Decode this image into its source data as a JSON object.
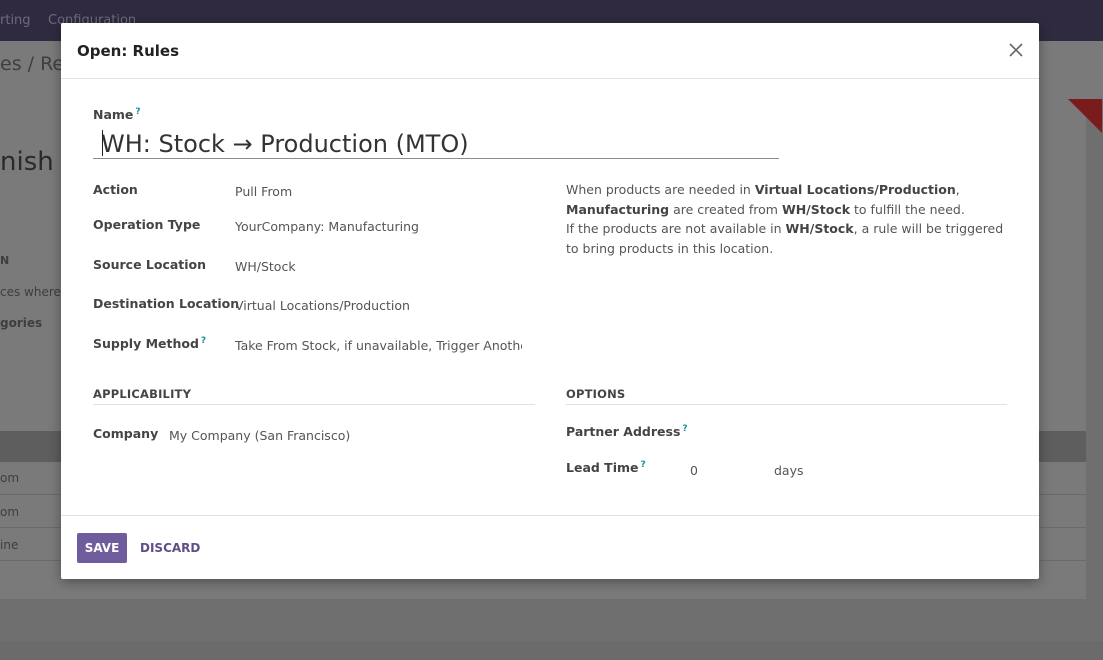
{
  "background": {
    "menu_items": [
      "rting",
      "Configuration"
    ],
    "breadcrumb": "es / Rep",
    "record_title": "nish o",
    "section_label": "N",
    "helper_text": "ces where",
    "categories_label": "gories",
    "rows": [
      "om",
      "om",
      "ine"
    ]
  },
  "modal": {
    "title": "Open: Rules",
    "close_icon": "close-icon"
  },
  "form": {
    "name_label": "Name",
    "name_value": "WH: Stock → Production (MTO)",
    "help_marker": "?",
    "fields": {
      "action_label": "Action",
      "action_value": "Pull From",
      "operation_type_label": "Operation Type",
      "operation_type_value": "YourCompany: Manufacturing",
      "source_location_label": "Source Location",
      "source_location_value": "WH/Stock",
      "destination_location_label": "Destination Location",
      "destination_location_value": "Virtual Locations/Production",
      "supply_method_label": "Supply Method",
      "supply_method_value": "Take From Stock, if unavailable, Trigger Another Rule"
    },
    "note": {
      "p1_a": "When products are needed in ",
      "p1_b": "Virtual Locations/Production",
      "p1_c": ",",
      "p1_d": "Manufacturing",
      "p1_e": " are created from ",
      "p1_f": "WH/Stock",
      "p1_g": " to fulfill the need.",
      "p2_a": "If the products are not available in ",
      "p2_b": "WH/Stock",
      "p2_c": ", a rule will be triggered to bring products in this location."
    },
    "applicability": {
      "heading": "APPLICABILITY",
      "company_label": "Company",
      "company_value": "My Company (San Francisco)"
    },
    "options": {
      "heading": "OPTIONS",
      "partner_address_label": "Partner Address",
      "lead_time_label": "Lead Time",
      "lead_time_value": "0",
      "lead_time_unit": "days"
    }
  },
  "footer": {
    "save_label": "SAVE",
    "discard_label": "DISCARD"
  },
  "colors": {
    "primary": "#6f5c9c",
    "help": "#1a8fa3"
  }
}
